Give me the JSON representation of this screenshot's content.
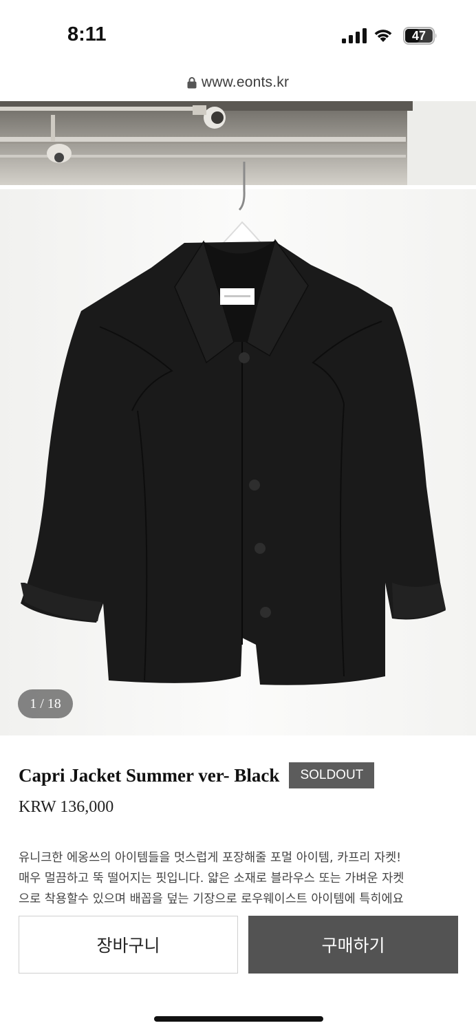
{
  "status_bar": {
    "time": "8:11",
    "battery_level": "47",
    "icons": [
      "signal-icon",
      "wifi-icon",
      "battery-icon"
    ]
  },
  "browser": {
    "url": "www.eonts.kr",
    "icon": "lock-icon"
  },
  "product": {
    "image_counter": "1 / 18",
    "title": "Capri Jacket Summer ver- Black",
    "status_badge": "SOLDOUT",
    "price": "KRW 136,000",
    "description_lines": [
      "유니크한 에옹쓰의 아이템들을 멋스럽게 포장해줄 포멀 아이템, 카프리 자켓!",
      "매우 멀끔하고 뚝 떨어지는 핏입니다. 얇은 소재로 블라우스 또는 가벼운 자켓",
      "으로 착용할수 있으며 배꼽을 덮는 기장으로 로우웨이스트 아이템에 특히에요"
    ]
  },
  "actions": {
    "cart_label": "장바구니",
    "buy_label": "구매하기"
  },
  "colors": {
    "badge": "#5c5c5c",
    "buy_button": "#535353",
    "jacket": "#1a1a1a"
  }
}
